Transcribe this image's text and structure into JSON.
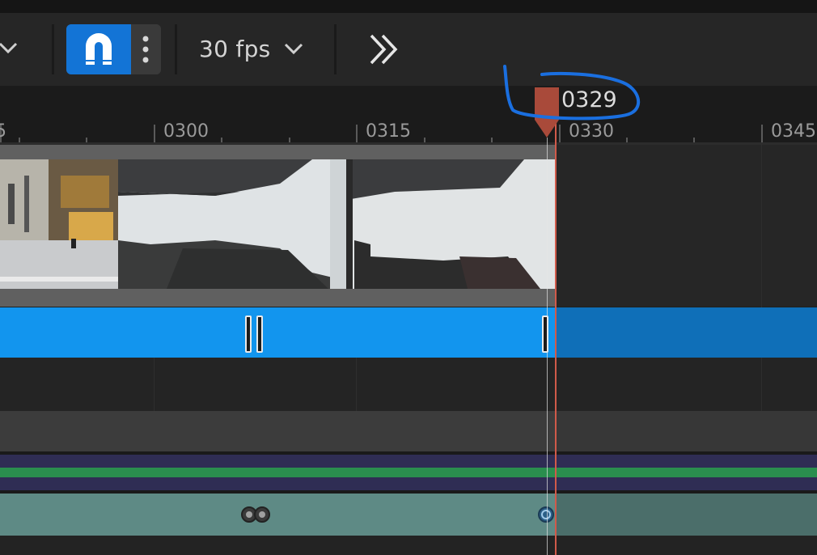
{
  "toolbar": {
    "fps_label": "30 fps",
    "snap_color": "#1374d6"
  },
  "ruler": {
    "labels": [
      "5",
      "0300",
      "0315",
      "0330",
      "0345"
    ]
  },
  "playhead": {
    "frame": "0329",
    "color": "#d05a4a"
  },
  "annotation": {
    "color": "#1a6fe0"
  },
  "tracks": {
    "clip_color": "#1295ee",
    "audio_color": "#5e8a85"
  }
}
